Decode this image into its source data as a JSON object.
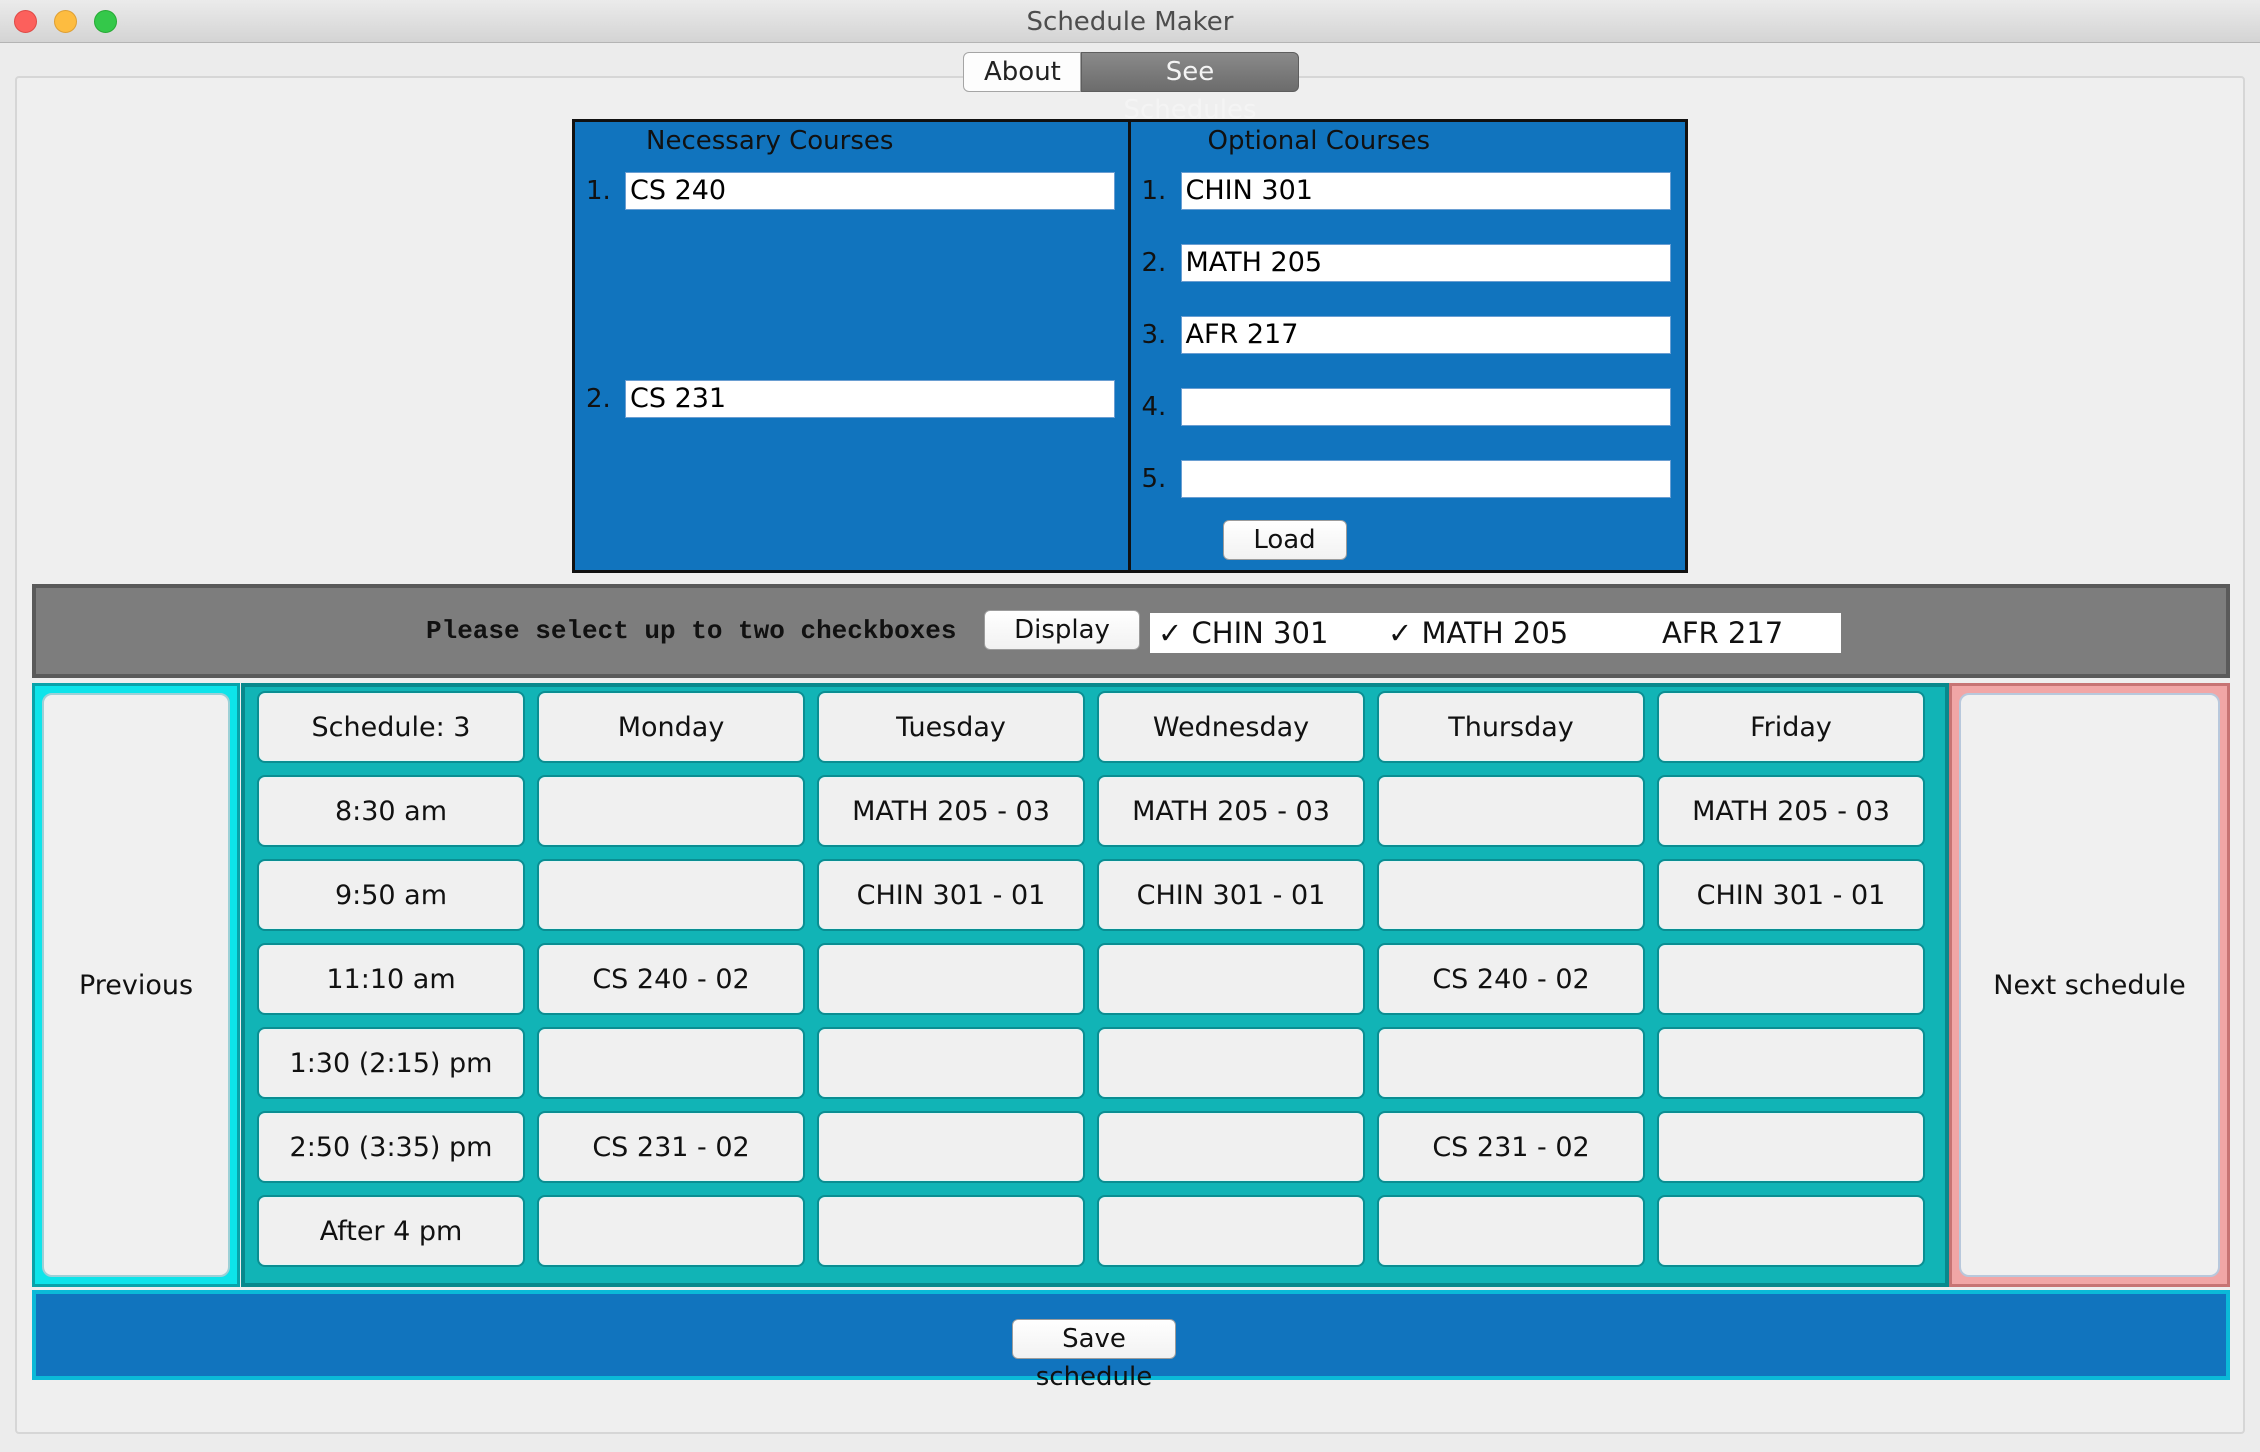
{
  "window": {
    "title": "Schedule Maker"
  },
  "tabs": [
    {
      "label": "About",
      "active": false
    },
    {
      "label": "See Schedules",
      "active": true
    }
  ],
  "courses": {
    "necessary": {
      "header": "Necessary Courses",
      "items": [
        {
          "num": "1.",
          "value": "CS 240"
        },
        {
          "num": "2.",
          "value": "CS 231"
        }
      ]
    },
    "optional": {
      "header": "Optional Courses",
      "items": [
        {
          "num": "1.",
          "value": "CHIN 301"
        },
        {
          "num": "2.",
          "value": "MATH 205"
        },
        {
          "num": "3.",
          "value": "AFR 217"
        },
        {
          "num": "4.",
          "value": ""
        },
        {
          "num": "5.",
          "value": ""
        }
      ],
      "load_label": "Load"
    }
  },
  "select_bar": {
    "prompt": "Please select up to two checkboxes",
    "display_label": "Display",
    "checkboxes": [
      {
        "label": "CHIN 301",
        "checked": true,
        "mark": "✓"
      },
      {
        "label": "MATH 205",
        "checked": true,
        "mark": "✓"
      },
      {
        "label": "AFR 217",
        "checked": false,
        "mark": ""
      }
    ]
  },
  "schedule": {
    "previous_label": "Previous",
    "next_label": "Next schedule",
    "header": [
      "Schedule: 3",
      "Monday",
      "Tuesday",
      "Wednesday",
      "Thursday",
      "Friday"
    ],
    "rows": [
      [
        "8:30 am",
        "",
        "MATH 205 - 03",
        "MATH 205 - 03",
        "",
        "MATH 205 - 03"
      ],
      [
        "9:50 am",
        "",
        "CHIN 301 - 01",
        "CHIN 301 - 01",
        "",
        "CHIN 301 - 01"
      ],
      [
        "11:10 am",
        "CS 240 - 02",
        "",
        "",
        "CS 240 - 02",
        ""
      ],
      [
        "1:30 (2:15) pm",
        "",
        "",
        "",
        "",
        ""
      ],
      [
        "2:50 (3:35) pm",
        "CS 231 - 02",
        "",
        "",
        "CS 231 - 02",
        ""
      ],
      [
        "After 4 pm",
        "",
        "",
        "",
        "",
        ""
      ]
    ]
  },
  "save_label": "Save schedule",
  "colors": {
    "panel_blue": "#1174be",
    "grid_teal": "#11b4b6",
    "prev_cyan": "#0de4ea",
    "next_pink": "#f1a6a6",
    "select_gray": "#7d7d7d"
  }
}
